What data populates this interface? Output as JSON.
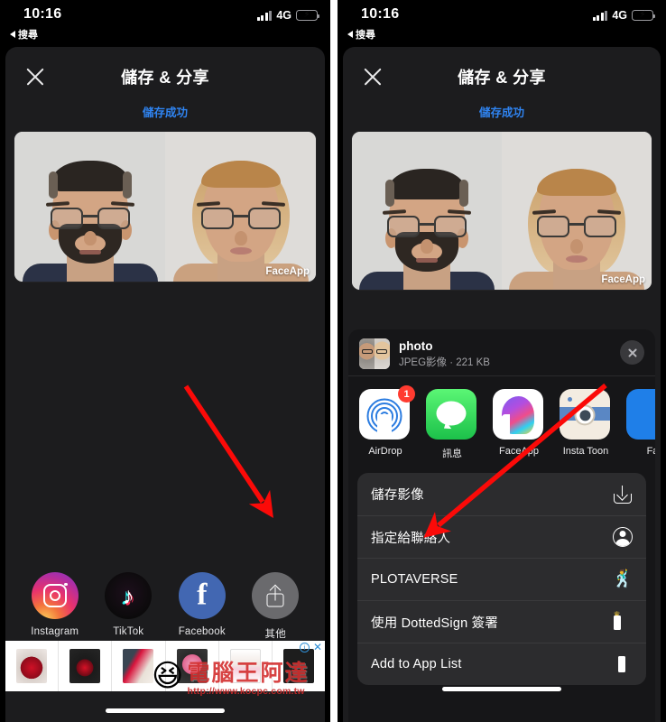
{
  "statusbar": {
    "time": "10:16",
    "back_label": "搜尋",
    "network": "4G",
    "signal_icon": "cellular-bars-icon",
    "battery_icon": "battery-charging-icon"
  },
  "app": {
    "close_icon": "close-icon",
    "title": "儲存 & 分享",
    "status_text": "儲存成功",
    "photo": {
      "watermark": "FaceApp",
      "left_face_alt": "原始男性人像",
      "right_face_alt": "轉換後女性人像"
    }
  },
  "left_panel": {
    "share_targets": [
      {
        "label": "Instagram",
        "icon": "instagram-icon"
      },
      {
        "label": "TikTok",
        "icon": "tiktok-icon"
      },
      {
        "label": "Facebook",
        "icon": "facebook-icon"
      },
      {
        "label": "其他",
        "icon": "share-out-icon"
      }
    ],
    "ad": {
      "info_icon": "ad-info-icon",
      "close_icon": "ad-close-icon",
      "products": [
        "玫瑰花束",
        "永生玫瑰禮盒",
        "紅玫瑰包裝",
        "粉紅花籃",
        "白色相框禮盒",
        "黑色禮品卡"
      ]
    }
  },
  "right_panel": {
    "share_sheet": {
      "file_name": "photo",
      "file_meta": "JPEG影像 · 221 KB",
      "thumb_icon": "photo-thumbnail",
      "close_icon": "close-icon",
      "apps": [
        {
          "label": "AirDrop",
          "icon": "airdrop-icon",
          "badge": "1"
        },
        {
          "label": "訊息",
          "icon": "messages-icon",
          "badge": ""
        },
        {
          "label": "FaceApp",
          "icon": "faceapp-icon",
          "badge": ""
        },
        {
          "label": "Insta Toon",
          "icon": "insta-toon-icon",
          "badge": ""
        },
        {
          "label": "Fa",
          "icon": "app-icon-cutoff",
          "badge": ""
        }
      ],
      "actions": [
        {
          "label": "儲存影像",
          "icon": "save-image-icon"
        },
        {
          "label": "指定給聯絡人",
          "icon": "assign-contact-icon"
        },
        {
          "label": "PLOTAVERSE",
          "icon": "plotaverse-icon"
        },
        {
          "label": "使用 DottedSign 簽署",
          "icon": "dottedsign-icon"
        },
        {
          "label": "Add to App List",
          "icon": "app-list-icon"
        }
      ]
    }
  },
  "annotations": {
    "left_arrow": {
      "name": "red-arrow-to-other-share",
      "points_to": "其他"
    },
    "right_arrow": {
      "name": "red-arrow-to-save-image",
      "points_to": "儲存影像"
    }
  },
  "watermark": {
    "brand": "電腦王阿達",
    "url": "http://www.kocpc.com.tw",
    "face_icon": "laughing-face-icon"
  }
}
